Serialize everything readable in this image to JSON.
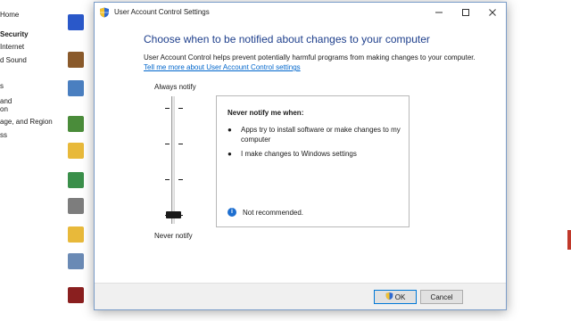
{
  "background": {
    "nav_items": [
      {
        "label": "Home",
        "active": false
      },
      {
        "label": "Security",
        "active": true
      },
      {
        "label": "Internet",
        "active": false
      },
      {
        "label": "d Sound",
        "active": false
      },
      {
        "label": "s",
        "active": false
      },
      {
        "label": "and",
        "active": false
      },
      {
        "label": "on",
        "active": false
      },
      {
        "label": "age, and Region",
        "active": false
      },
      {
        "label": "ss",
        "active": false
      }
    ],
    "icon_colors": [
      "#2a58c9",
      "#8a5a2b",
      "#4a7fc0",
      "#4a8c3a",
      "#e8b93a",
      "#3a8f4a",
      "#7d7d7d",
      "#e8b93a",
      "#6a8ab5",
      "#8a1f1f"
    ]
  },
  "dialog": {
    "title": "User Account Control Settings",
    "heading": "Choose when to be notified about changes to your computer",
    "description": "User Account Control helps prevent potentially harmful programs from making changes to your computer.",
    "learn_more_link": "Tell me more about User Account Control settings",
    "slider": {
      "top_label": "Always notify",
      "bottom_label": "Never notify",
      "levels": 4,
      "selected_level": 1
    },
    "info": {
      "title": "Never notify me when:",
      "bullets": [
        "Apps try to install software or make changes to my computer",
        "I make changes to Windows settings"
      ],
      "recommendation": "Not recommended."
    },
    "buttons": {
      "ok": "OK",
      "cancel": "Cancel"
    }
  },
  "colors": {
    "heading_blue": "#1e3f8c",
    "link_blue": "#0066cc",
    "info_blue": "#1e6fd0",
    "ok_border": "#0078d7"
  }
}
